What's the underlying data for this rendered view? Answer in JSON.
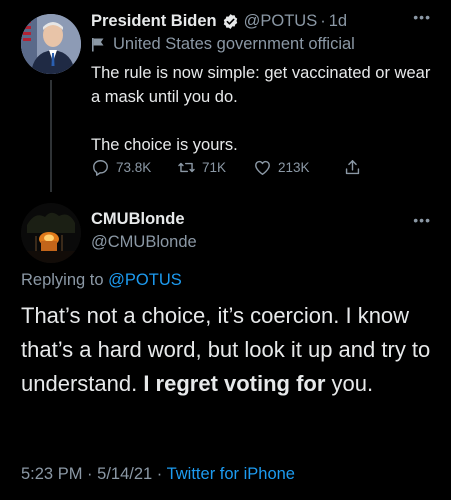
{
  "parent_tweet": {
    "display_name": "President Biden",
    "handle": "@POTUS",
    "time_separator": "·",
    "time": "1d",
    "label": "United States government official",
    "text": "The rule is now simple: get vaccinated or wear a mask until you do.\n\nThe choice is yours.",
    "replies": "73.8K",
    "retweets": "71K",
    "likes": "213K"
  },
  "reply_tweet": {
    "display_name": "CMUBlonde",
    "handle": "@CMUBlonde",
    "replying_prefix": "Replying to",
    "replying_to": "@POTUS",
    "text_plain": "That’s not a choice, it’s coercion. I know that’s a hard word, but look it up and try to understand. ",
    "text_bold_1": "I regret voting for",
    "text_end": " you.",
    "time": "5:23 PM",
    "date_separator": "·",
    "date": "5/14/21",
    "source_separator": "·",
    "source": "Twitter for iPhone"
  },
  "icons": {
    "verified": "verified-badge-icon",
    "government": "flag-icon",
    "reply": "reply-icon",
    "retweet": "retweet-icon",
    "like": "heart-icon",
    "share": "share-icon",
    "more": "more-icon"
  },
  "colors": {
    "background": "#000000",
    "text": "#e7e9ea",
    "secondary": "#8b98a5",
    "accent": "#1d9bf0"
  }
}
